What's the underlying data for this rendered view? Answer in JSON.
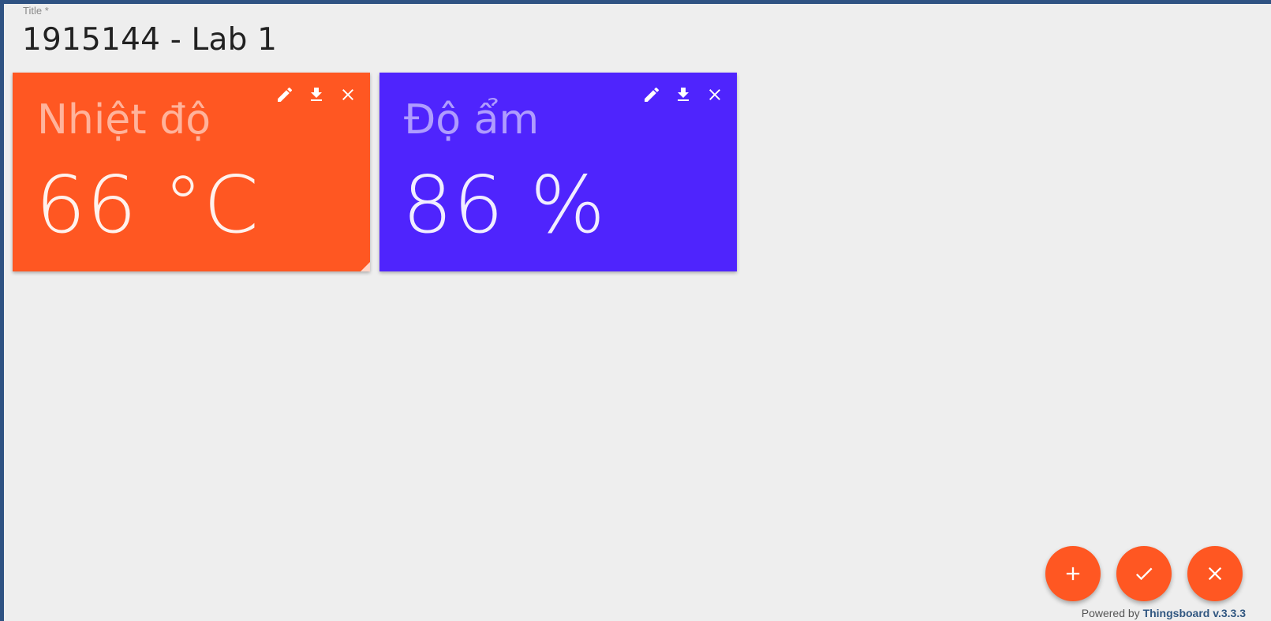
{
  "header": {
    "title_label": "Title *",
    "title_value": "1915144 - Lab 1"
  },
  "widgets": [
    {
      "title": "Nhiệt độ",
      "value": "66 °C",
      "background_color": "#ff5722",
      "actions": [
        "edit-icon",
        "download-icon",
        "close-icon"
      ]
    },
    {
      "title": "Độ ẩm",
      "value": "86 %",
      "background_color": "#4f24fd",
      "actions": [
        "edit-icon",
        "download-icon",
        "close-icon"
      ]
    }
  ],
  "fab": {
    "color": "#ff5722",
    "buttons": [
      "add-icon",
      "check-icon",
      "close-icon"
    ]
  },
  "footer": {
    "powered_by": "Powered by",
    "link_text": "Thingsboard v.3.3.3"
  },
  "colors": {
    "frame": "#2f5282",
    "background": "#eeeeee",
    "link": "#305680"
  }
}
